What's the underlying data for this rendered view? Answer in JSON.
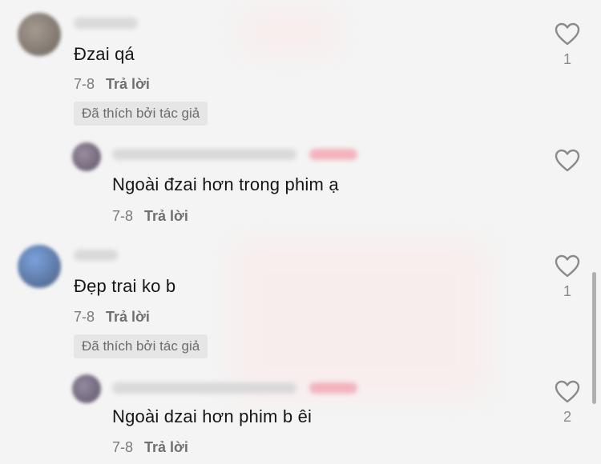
{
  "comments": [
    {
      "text": "Đzai qá",
      "date": "7-8",
      "reply_label": "Trả lời",
      "liked_badge": "Đã thích bởi tác giả",
      "like_count": "1",
      "avatar_color": "#8f857c"
    },
    {
      "text": "Ngoài đzai hơn trong phim ạ",
      "date": "7-8",
      "reply_label": "Trả lời",
      "like_count": "",
      "avatar_color": "#7d6f83"
    },
    {
      "text": "Đẹp trai ko b",
      "date": "7-8",
      "reply_label": "Trả lời",
      "liked_badge": "Đã thích bởi tác giả",
      "like_count": "1",
      "avatar_color": "#5b84c4"
    },
    {
      "text": "Ngoài dzai hơn phim b êi",
      "date": "7-8",
      "reply_label": "Trả lời",
      "like_count": "2",
      "avatar_color": "#7a6f80"
    }
  ],
  "icons": {
    "like": "heart-outline-icon"
  },
  "colors": {
    "background": "#f4f4f4",
    "text": "#161616",
    "meta": "#7a7a7a",
    "badge_bg": "#e6e6e6"
  }
}
